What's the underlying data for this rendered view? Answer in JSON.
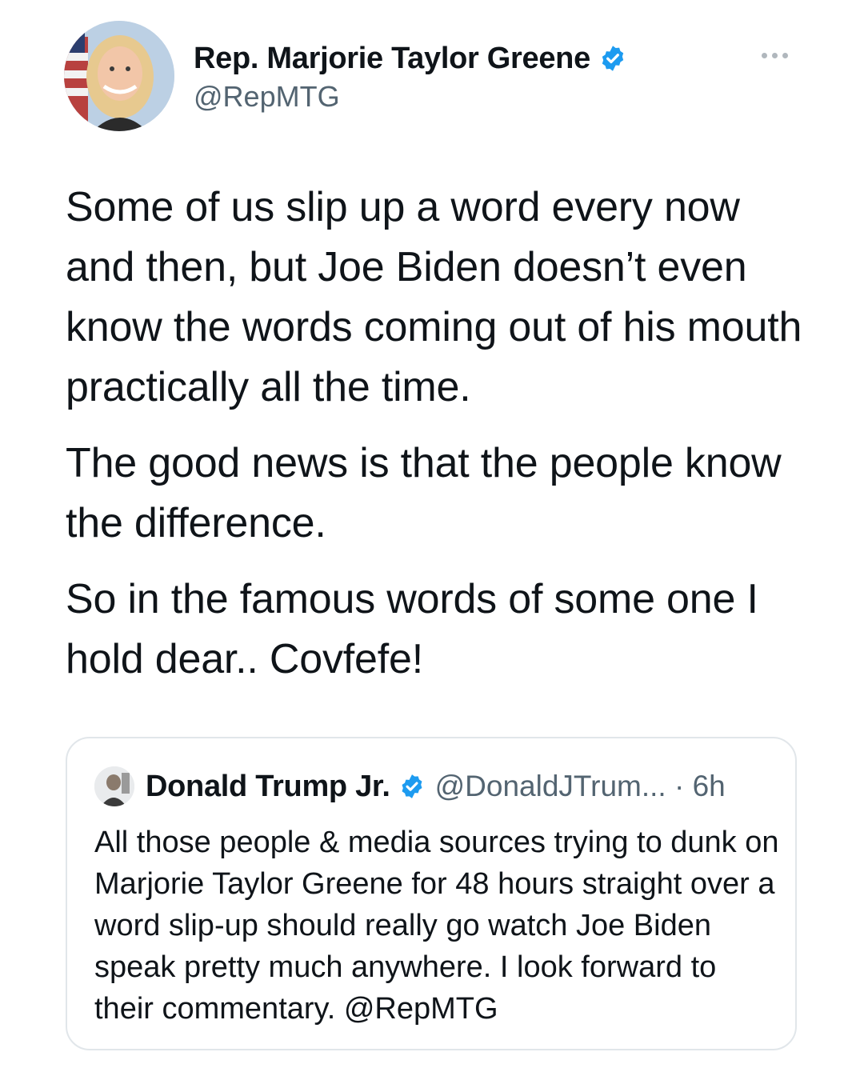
{
  "author": {
    "display_name": "Rep. Marjorie Taylor Greene",
    "handle": "@RepMTG",
    "verified_icon": "verified-badge-icon",
    "avatar_icon": "avatar"
  },
  "more_icon": "more-dots-icon",
  "tweet": {
    "paragraphs": [
      "Some of us slip up a word every now and then, but Joe Biden doesn’t even know the words coming out of his mouth practically all the time.",
      "The good news is that the people know the difference.",
      "So in the famous words of some one I hold dear..  Covfefe!"
    ]
  },
  "quoted": {
    "display_name": "Donald Trump Jr.",
    "handle_time": "@DonaldJTrum... · 6h",
    "text": "All those people & media sources trying to dunk on Marjorie Taylor Greene for 48 hours straight over a word slip-up should really go watch Joe Biden speak pretty much anywhere. I look forward to their commentary. @RepMTG"
  },
  "colors": {
    "verified_blue": "#1d9bf0",
    "secondary_text": "#536471",
    "border": "#e1e6ea"
  }
}
